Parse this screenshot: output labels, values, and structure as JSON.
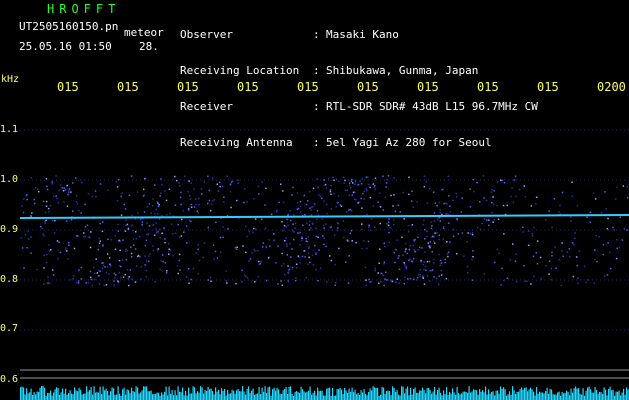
{
  "header": {
    "brand": "HROFFT",
    "filename": "UT2505160150.pn",
    "meteor_label": "meteor",
    "datetime": "25.05.16 01:50",
    "count": "28.",
    "fields": [
      {
        "label": "Observer",
        "value": "Masaki Kano"
      },
      {
        "label": "Receiving Location",
        "value": "Shibukawa, Gunma, Japan"
      },
      {
        "label": "Receiver",
        "value": "RTL-SDR SDR# 43dB L15 96.7MHz CW"
      },
      {
        "label": "Receiving Antenna",
        "value": "5el Yagi Az 280 for Seoul"
      }
    ],
    "separator": ":"
  },
  "axes": {
    "y_unit": "kHz",
    "x_ticks": [
      "015",
      "015",
      "015",
      "015",
      "015",
      "015",
      "015",
      "015",
      "015",
      "0200"
    ],
    "y_ticks": [
      "1.1",
      "1.0",
      "0.9",
      "0.8",
      "0.7",
      "0.6"
    ]
  },
  "colors": {
    "background": "#000000",
    "tick_text": "#ffff66",
    "brand": "#22ff22",
    "signal": "#4466ff",
    "carrier": "#33ccff",
    "noise_floor": "#22d8ff"
  }
}
